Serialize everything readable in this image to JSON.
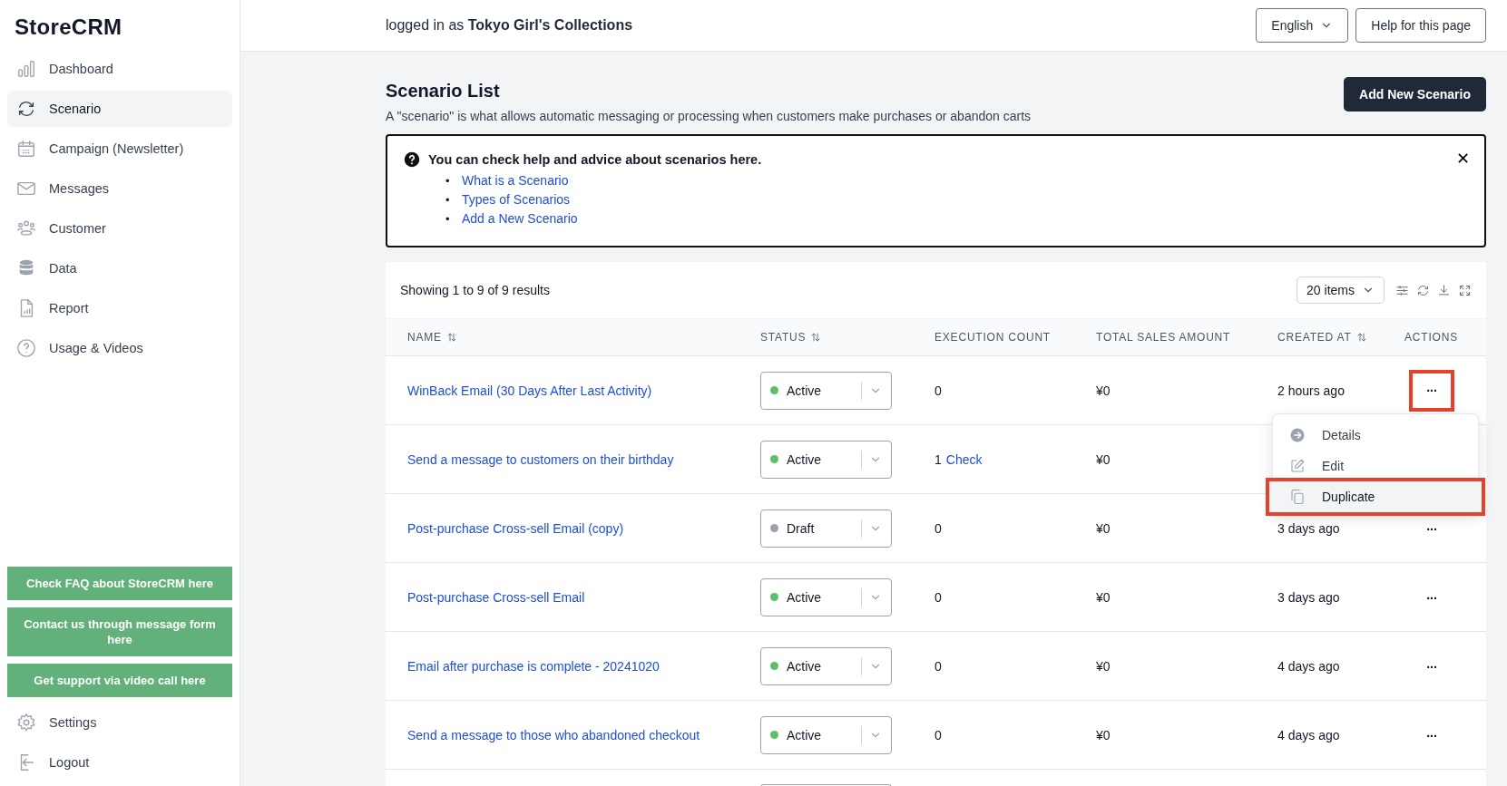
{
  "sidebar": {
    "logo": "StoreCRM",
    "items": [
      {
        "label": "Dashboard",
        "selected": false
      },
      {
        "label": "Scenario",
        "selected": true
      },
      {
        "label": "Campaign (Newsletter)",
        "selected": false
      },
      {
        "label": "Messages",
        "selected": false
      },
      {
        "label": "Customer",
        "selected": false
      },
      {
        "label": "Data",
        "selected": false
      },
      {
        "label": "Report",
        "selected": false
      },
      {
        "label": "Usage & Videos",
        "selected": false
      }
    ],
    "support_buttons": [
      "Check FAQ about StoreCRM here",
      "Contact us through message form here",
      "Get support via video call here"
    ],
    "bottom_items": [
      {
        "label": "Settings"
      },
      {
        "label": "Logout"
      }
    ]
  },
  "header": {
    "logged_in": "logged in as **Tokyo Girl's Collections**",
    "language": "English",
    "help_button": "Help for this page"
  },
  "page": {
    "title": "Scenario List",
    "description": "A \"scenario\" is what allows automatic messaging or processing when customers make purchases or abandon carts",
    "add_button": "Add New Scenario"
  },
  "help_box": {
    "heading": "You can check help and advice about scenarios here.",
    "links": [
      {
        "marker": "•",
        "label": "What is a Scenario"
      },
      {
        "marker": "•",
        "label": "Types of Scenarios"
      },
      {
        "marker": "•",
        "label": "Add a New Scenario"
      }
    ],
    "close": "✕"
  },
  "table": {
    "summary": "Showing 1 to 9 of 9 results",
    "page_size": "20 items",
    "columns": [
      {
        "label": "NAME",
        "sortable": true
      },
      {
        "label": "STATUS",
        "sortable": true
      },
      {
        "label": "EXECUTION COUNT",
        "sortable": false
      },
      {
        "label": "TOTAL SALES AMOUNT",
        "sortable": false
      },
      {
        "label": "CREATED AT",
        "sortable": true
      },
      {
        "label": "ACTIONS",
        "sortable": false
      }
    ],
    "rows": [
      {
        "name": "WinBack Email (30 Days After Last Activity)",
        "status": "Active",
        "color": "#5cc06a",
        "execution_count": "0",
        "sales": "¥0",
        "created_at": "2 hours ago",
        "actions": "...",
        "highlighted": true
      },
      {
        "name": "Send a message to customers on their birthday",
        "status": "Active",
        "color": "#5cc06a",
        "execution_count": "1",
        "execution_link": "Check",
        "sales": "¥0"
      },
      {
        "name": "Post-purchase Cross-sell Email (copy)",
        "status": "Draft",
        "color": "#9ca3af",
        "execution_count": "0",
        "sales": "¥0",
        "created_at": "3 days ago",
        "actions": "...",
        "highlighted": false
      },
      {
        "name": "Post-purchase Cross-sell Email",
        "status": "Active",
        "color": "#5cc06a",
        "execution_count": "0",
        "sales": "¥0",
        "created_at": "3 days ago",
        "actions": "...",
        "highlighted": false
      },
      {
        "name": "Email after purchase is complete - 20241020",
        "status": "Active",
        "color": "#5cc06a",
        "execution_count": "0",
        "sales": "¥0",
        "created_at": "4 days ago",
        "actions": "...",
        "highlighted": false
      },
      {
        "name": "Send a message to those who abandoned checkout",
        "status": "Active",
        "color": "#5cc06a",
        "execution_count": "0",
        "sales": "¥0",
        "created_at": "4 days ago",
        "actions": "...",
        "highlighted": false
      }
    ],
    "more_rows_below": true
  },
  "action_menu": {
    "items": [
      {
        "label": "Details",
        "highlighted": false
      },
      {
        "label": "Edit",
        "highlighted": false
      },
      {
        "label": "Duplicate",
        "highlighted": true
      }
    ]
  }
}
